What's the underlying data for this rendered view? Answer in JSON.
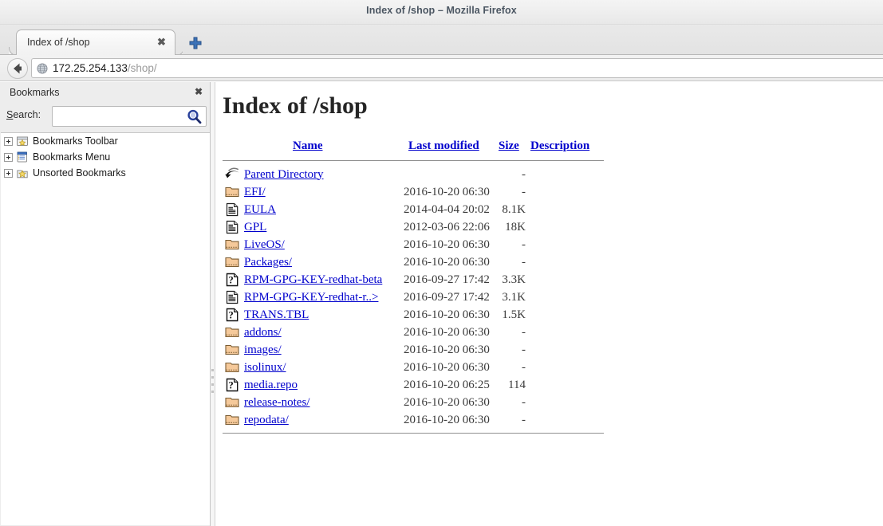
{
  "window": {
    "title": "Index of /shop – Mozilla Firefox"
  },
  "tab": {
    "label": "Index of /shop",
    "close_label": "✖",
    "new_tab_icon": "plus-icon"
  },
  "navbar": {
    "back_icon": "back-arrow-icon",
    "favicon": "globe-icon",
    "url_host": "172.25.254.133",
    "url_path": "/shop/"
  },
  "sidebar": {
    "title": "Bookmarks",
    "close_label": "✖",
    "search_label_pre": "S",
    "search_label_post": "earch:",
    "search_value": "",
    "search_placeholder": "",
    "search_icon": "magnifier-icon",
    "items": [
      {
        "label": "Bookmarks Toolbar",
        "icon": "bookmarks-toolbar-icon",
        "expanded": false
      },
      {
        "label": "Bookmarks Menu",
        "icon": "bookmarks-menu-icon",
        "expanded": false
      },
      {
        "label": "Unsorted Bookmarks",
        "icon": "unsorted-bookmarks-icon",
        "expanded": false
      }
    ]
  },
  "page": {
    "heading": "Index of /shop",
    "columns": {
      "name": "Name",
      "last_modified": "Last modified",
      "size": "Size",
      "description": "Description"
    },
    "rows": [
      {
        "icon": "parent-directory-icon",
        "name": "Parent Directory",
        "modified": "",
        "size": "-",
        "description": ""
      },
      {
        "icon": "folder-icon",
        "name": "EFI/",
        "modified": "2016-10-20 06:30",
        "size": "-",
        "description": ""
      },
      {
        "icon": "document-icon",
        "name": "EULA",
        "modified": "2014-04-04 20:02",
        "size": "8.1K",
        "description": ""
      },
      {
        "icon": "document-icon",
        "name": "GPL",
        "modified": "2012-03-06 22:06",
        "size": "18K",
        "description": ""
      },
      {
        "icon": "folder-icon",
        "name": "LiveOS/",
        "modified": "2016-10-20 06:30",
        "size": "-",
        "description": ""
      },
      {
        "icon": "folder-icon",
        "name": "Packages/",
        "modified": "2016-10-20 06:30",
        "size": "-",
        "description": ""
      },
      {
        "icon": "unknown-icon",
        "name": "RPM-GPG-KEY-redhat-beta",
        "modified": "2016-09-27 17:42",
        "size": "3.3K",
        "description": ""
      },
      {
        "icon": "document-icon",
        "name": "RPM-GPG-KEY-redhat-r..>",
        "modified": "2016-09-27 17:42",
        "size": "3.1K",
        "description": ""
      },
      {
        "icon": "unknown-icon",
        "name": "TRANS.TBL",
        "modified": "2016-10-20 06:30",
        "size": "1.5K",
        "description": ""
      },
      {
        "icon": "folder-icon",
        "name": "addons/",
        "modified": "2016-10-20 06:30",
        "size": "-",
        "description": ""
      },
      {
        "icon": "folder-icon",
        "name": "images/",
        "modified": "2016-10-20 06:30",
        "size": "-",
        "description": ""
      },
      {
        "icon": "folder-icon",
        "name": "isolinux/",
        "modified": "2016-10-20 06:30",
        "size": "-",
        "description": ""
      },
      {
        "icon": "unknown-icon",
        "name": "media.repo",
        "modified": "2016-10-20 06:25",
        "size": "114",
        "description": ""
      },
      {
        "icon": "folder-icon",
        "name": "release-notes/",
        "modified": "2016-10-20 06:30",
        "size": "-",
        "description": ""
      },
      {
        "icon": "folder-icon",
        "name": "repodata/",
        "modified": "2016-10-20 06:30",
        "size": "-",
        "description": ""
      }
    ]
  },
  "colors": {
    "link": "#0000cc",
    "titlebar_text": "#4b5662",
    "folder": "#f5c99a",
    "accent_blue": "#2b5fa8"
  }
}
